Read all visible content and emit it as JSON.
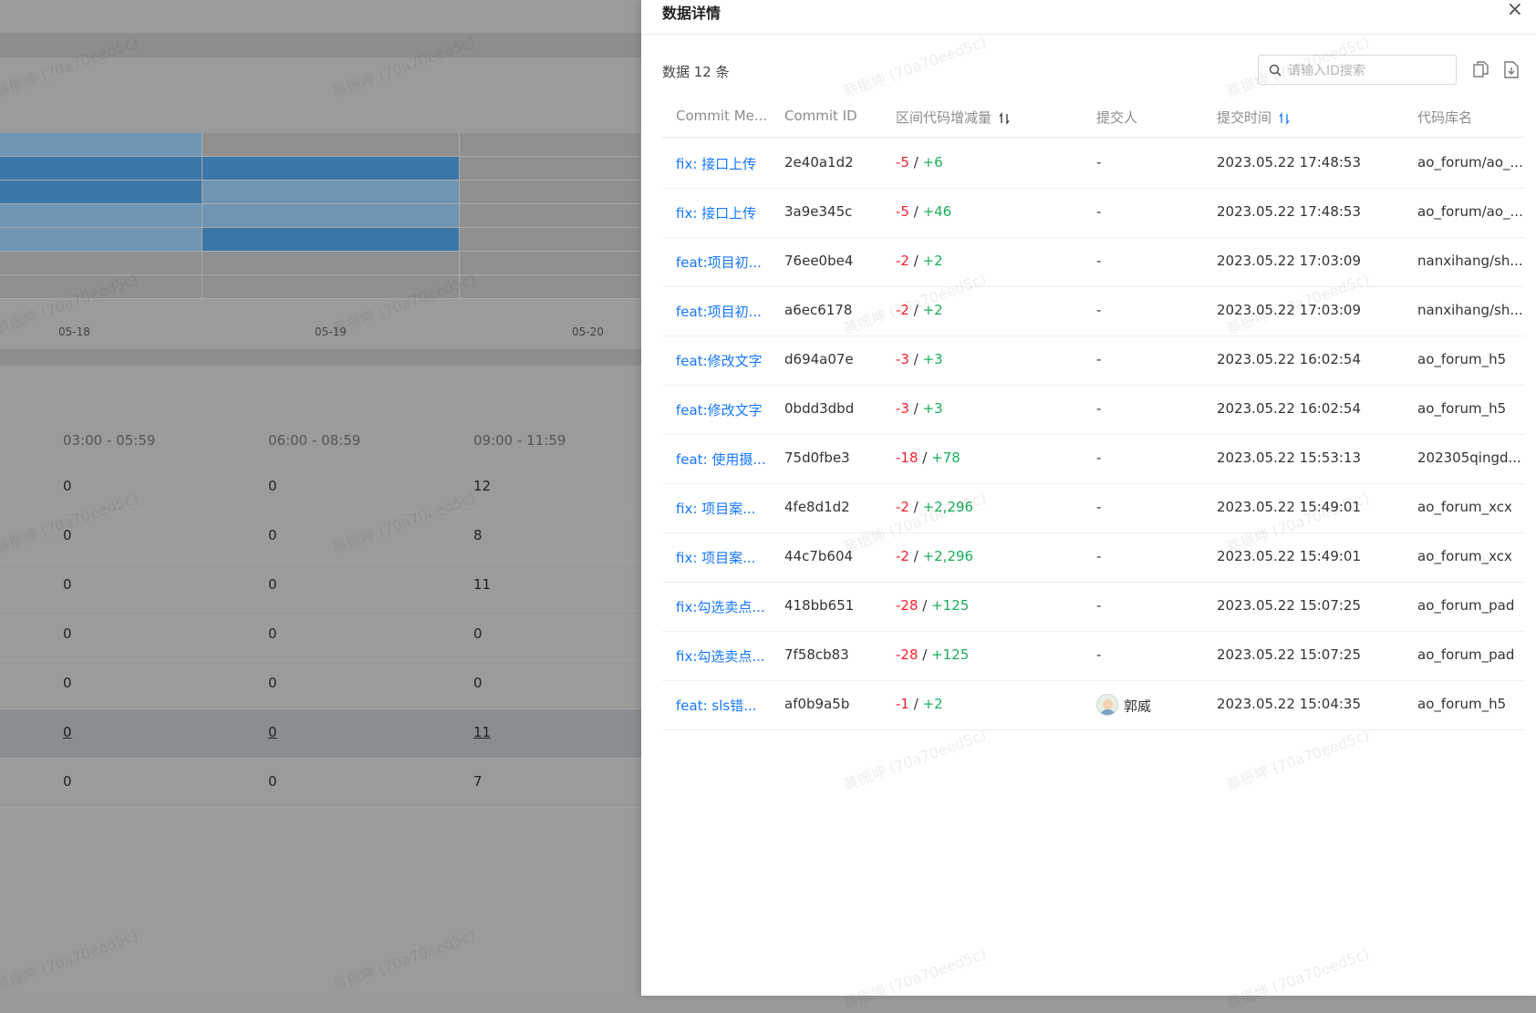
{
  "background": {
    "heatmap": {
      "axis_labels": [
        "05-18",
        "05-19",
        "05-20"
      ],
      "rows": [
        [
          "light",
          "gray",
          "gray"
        ],
        [
          "dark",
          "dark",
          "gray"
        ],
        [
          "dark",
          "light",
          "gray"
        ],
        [
          "light",
          "light",
          "gray"
        ],
        [
          "light",
          "dark",
          "gray"
        ],
        [
          "gray",
          "gray",
          "gray"
        ],
        [
          "gray",
          "gray",
          "gray"
        ]
      ]
    },
    "table": {
      "headers": [
        "03:00 - 05:59",
        "06:00 - 08:59",
        "09:00 - 11:59"
      ],
      "rows": [
        [
          "0",
          "0",
          "12"
        ],
        [
          "0",
          "0",
          "8"
        ],
        [
          "0",
          "0",
          "11"
        ],
        [
          "0",
          "0",
          "0"
        ],
        [
          "0",
          "0",
          "0"
        ],
        [
          "0",
          "0",
          "11"
        ],
        [
          "0",
          "0",
          "7"
        ]
      ],
      "highlighted_row": 5
    },
    "watermark": "蔡振坤 (70a70eed5c)"
  },
  "drawer": {
    "title": "数据详情",
    "close_symbol": "×",
    "count": "数据 12 条",
    "search_placeholder": "请输入ID搜索",
    "toolbar_icons": [
      "copy-icon",
      "download-icon"
    ],
    "columns": [
      "Commit Me...",
      "Commit ID",
      "区间代码增减量",
      "提交人",
      "提交时间",
      "代码库名"
    ],
    "rows": [
      {
        "msg": "fix: 接口上传",
        "id": "2e40a1d2",
        "del": "-5",
        "add": "+6",
        "user": "-",
        "time": "2023.05.22 17:48:53",
        "repo": "ao_forum/ao_..."
      },
      {
        "msg": "fix: 接口上传",
        "id": "3a9e345c",
        "del": "-5",
        "add": "+46",
        "user": "-",
        "time": "2023.05.22 17:48:53",
        "repo": "ao_forum/ao_..."
      },
      {
        "msg": "feat:项目初...",
        "id": "76ee0be4",
        "del": "-2",
        "add": "+2",
        "user": "-",
        "time": "2023.05.22 17:03:09",
        "repo": "nanxihang/sh..."
      },
      {
        "msg": "feat:项目初...",
        "id": "a6ec6178",
        "del": "-2",
        "add": "+2",
        "user": "-",
        "time": "2023.05.22 17:03:09",
        "repo": "nanxihang/sh..."
      },
      {
        "msg": "feat:修改文字",
        "id": "d694a07e",
        "del": "-3",
        "add": "+3",
        "user": "-",
        "time": "2023.05.22 16:02:54",
        "repo": "ao_forum_h5"
      },
      {
        "msg": "feat:修改文字",
        "id": "0bdd3dbd",
        "del": "-3",
        "add": "+3",
        "user": "-",
        "time": "2023.05.22 16:02:54",
        "repo": "ao_forum_h5"
      },
      {
        "msg": "feat: 使用摄...",
        "id": "75d0fbe3",
        "del": "-18",
        "add": "+78",
        "user": "-",
        "time": "2023.05.22 15:53:13",
        "repo": "202305qingd..."
      },
      {
        "msg": "fix: 项目案...",
        "id": "4fe8d1d2",
        "del": "-2",
        "add": "+2,296",
        "user": "-",
        "time": "2023.05.22 15:49:01",
        "repo": "ao_forum_xcx"
      },
      {
        "msg": "fix: 项目案...",
        "id": "44c7b604",
        "del": "-2",
        "add": "+2,296",
        "user": "-",
        "time": "2023.05.22 15:49:01",
        "repo": "ao_forum_xcx"
      },
      {
        "msg": "fix:勾选卖点...",
        "id": "418bb651",
        "del": "-28",
        "add": "+125",
        "user": "-",
        "time": "2023.05.22 15:07:25",
        "repo": "ao_forum_pad"
      },
      {
        "msg": "fix:勾选卖点...",
        "id": "7f58cb83",
        "del": "-28",
        "add": "+125",
        "user": "-",
        "time": "2023.05.22 15:07:25",
        "repo": "ao_forum_pad"
      },
      {
        "msg": "feat: sls错...",
        "id": "af0b9a5b",
        "del": "-1",
        "add": "+2",
        "user": "郭威",
        "avatar": true,
        "time": "2023.05.22 15:04:35",
        "repo": "ao_forum_h5"
      }
    ]
  }
}
